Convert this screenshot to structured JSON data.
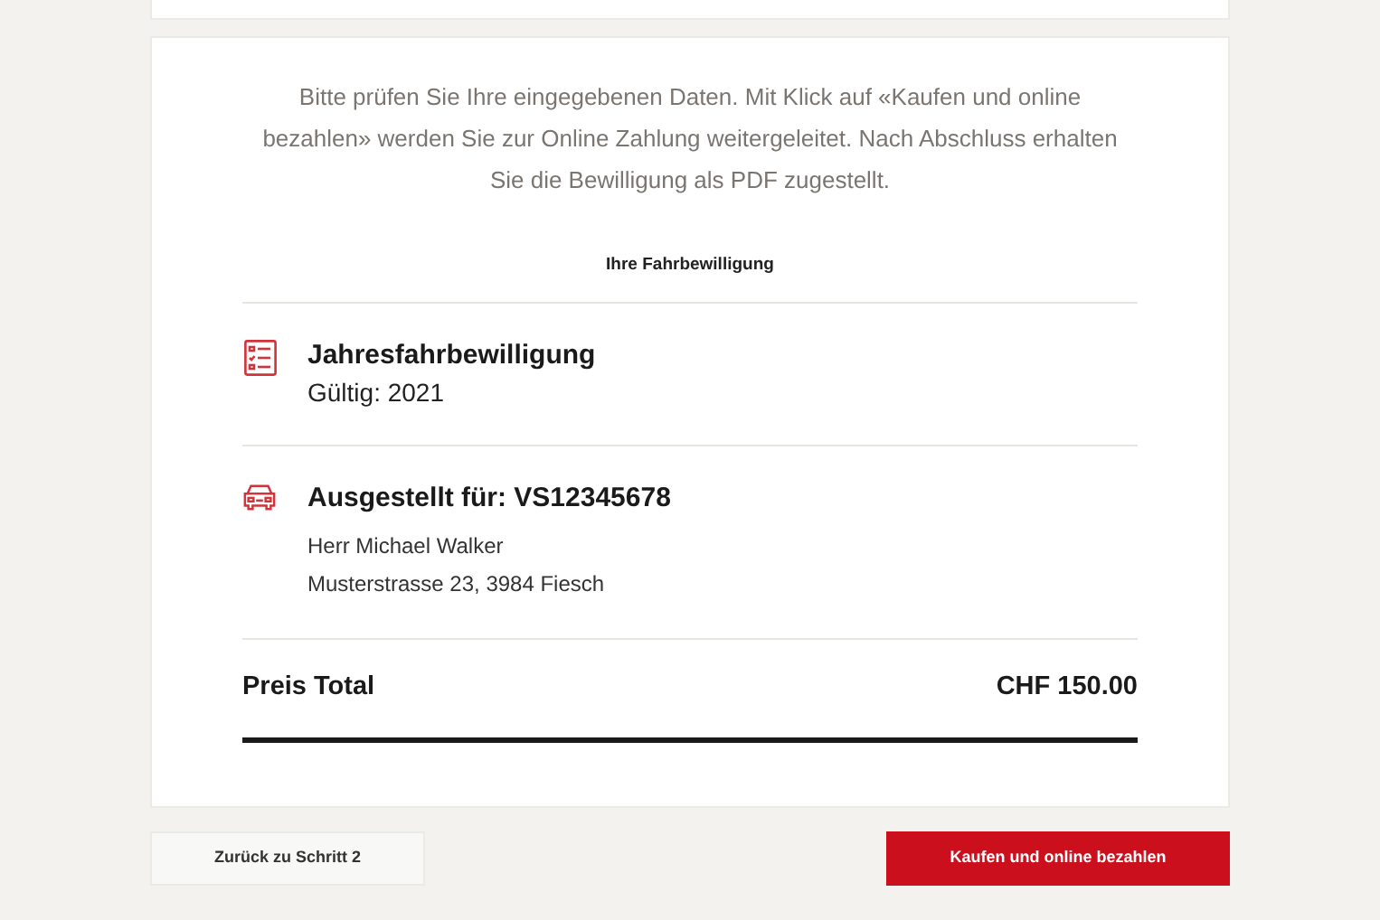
{
  "intro": "Bitte prüfen Sie Ihre eingegebenen Daten. Mit Klick auf «Kaufen und online bezahlen» werden Sie zur Online Zahlung weitergeleitet. Nach Abschluss erhalten Sie die Bewilligung als PDF zugestellt.",
  "section_title": "Ihre Fahrbewilligung",
  "items": [
    {
      "kind": "permit",
      "title": "Jahresfahrbewilligung",
      "lines": [
        "Gültig: 2021"
      ]
    },
    {
      "kind": "vehicle",
      "title": "Ausgestellt für: VS12345678",
      "lines": [
        "Herr Michael Walker",
        "Musterstrasse 23, 3984 Fiesch"
      ]
    }
  ],
  "total": {
    "label": "Preis Total",
    "amount": "CHF 150.00"
  },
  "buttons": [
    {
      "label": "Zurück zu Schritt 2",
      "kind": "secondary"
    },
    {
      "label": "Kaufen und online bezahlen",
      "kind": "primary"
    }
  ]
}
